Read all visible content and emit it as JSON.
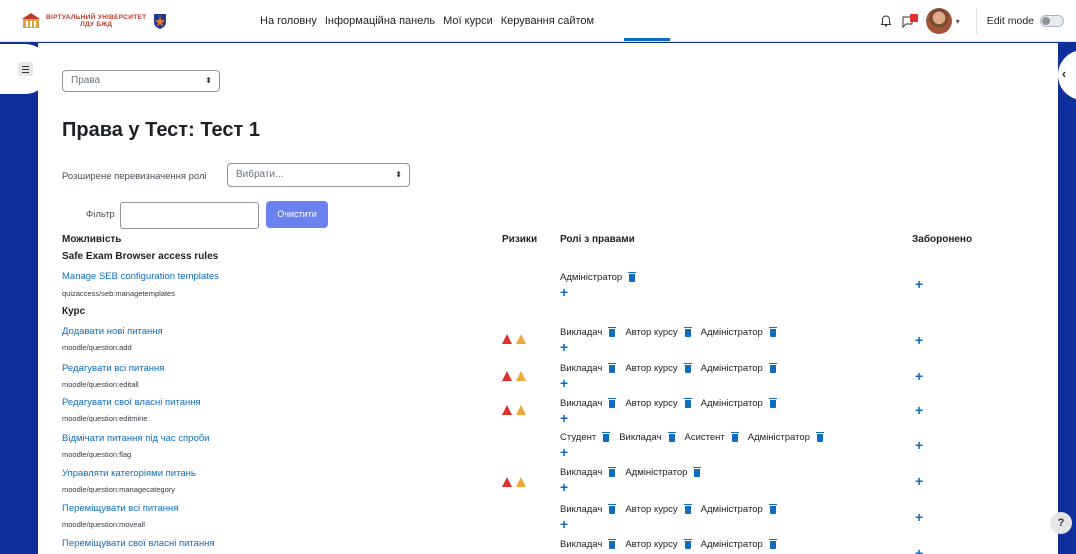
{
  "navbar": {
    "logo_line1": "ВІРТУАЛЬНИЙ УНІВЕРСИТЕТ",
    "logo_line2": "ЛДУ БЖД",
    "links": [
      "На головну",
      "Інформаційна панель",
      "Мої курси",
      "Керування сайтом"
    ],
    "edit_mode_label": "Edit mode"
  },
  "page": {
    "select_label": "Права",
    "title": "Права у Тест: Тест 1",
    "override_label": "Розширене перевизначення ролі",
    "override_select": "Вибрати...",
    "filter_label": "Фільтр",
    "clear_button": "Очистити"
  },
  "table": {
    "headers": {
      "capability": "Можливість",
      "risks": "Ризики",
      "roles": "Ролі з правами",
      "prohibited": "Заборонено"
    },
    "groups": [
      "Safe Exam Browser access rules",
      "Курс"
    ],
    "rows": [
      {
        "name": "Manage SEB configuration templates",
        "code": "quizaccess/seb:managetemplates",
        "roles": [
          "Адміністратор"
        ]
      },
      {
        "name": "Додавати нові питання",
        "code": "moodle/question:add",
        "roles": [
          "Викладач",
          "Автор курсу",
          "Адміністратор"
        ]
      },
      {
        "name": "Редагувати всі питання",
        "code": "moodle/question:editall",
        "roles": [
          "Викладач",
          "Автор курсу",
          "Адміністратор"
        ]
      },
      {
        "name": "Редагувати свої власні питання",
        "code": "moodle/question:editmine",
        "roles": [
          "Викладач",
          "Автор курсу",
          "Адміністратор"
        ]
      },
      {
        "name": "Відмічати питання під час спроби",
        "code": "moodle/question:flag",
        "roles": [
          "Студент",
          "Викладач",
          "Асистент",
          "Адміністратор"
        ]
      },
      {
        "name": "Управляти категоріями питань",
        "code": "moodle/question:managecategory",
        "roles": [
          "Викладач",
          "Адміністратор"
        ]
      },
      {
        "name": "Переміщувати всі питання",
        "code": "moodle/question:moveall",
        "roles": [
          "Викладач",
          "Автор курсу",
          "Адміністратор"
        ]
      },
      {
        "name": "Переміщувати свої власні питання",
        "code": "",
        "roles": [
          "Викладач",
          "Автор курсу",
          "Адміністратор"
        ]
      }
    ]
  },
  "help_label": "?",
  "colors": {
    "frame": "#0f2f9c",
    "link": "#0f6cbf",
    "button": "#6a82f0",
    "risk_red": "#e03131",
    "risk_orange": "#f2a93b"
  }
}
